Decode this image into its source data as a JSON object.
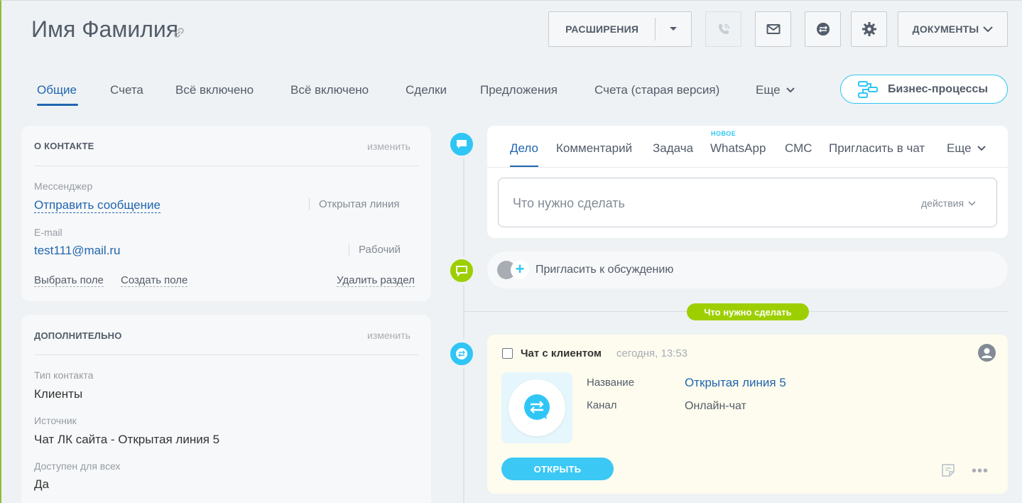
{
  "header": {
    "title": "Имя Фамилия",
    "extensions_label": "РАСШИРЕНИЯ",
    "documents_label": "ДОКУМЕНТЫ"
  },
  "tabs": [
    {
      "label": "Общие",
      "active": true
    },
    {
      "label": "Счета"
    },
    {
      "label": "Всё включено"
    },
    {
      "label": "Всё включено"
    },
    {
      "label": "Сделки"
    },
    {
      "label": "Предложения"
    },
    {
      "label": "Счета (старая версия)"
    },
    {
      "label": "Еще"
    }
  ],
  "business_processes_label": "Бизнес-процессы",
  "contact_card": {
    "title": "О КОНТАКТЕ",
    "edit_label": "изменить",
    "messenger_label": "Мессенджер",
    "messenger_value": "Отправить сообщение",
    "messenger_type": "Открытая линия",
    "email_label": "E-mail",
    "email_value": "test111@mail.ru",
    "email_type": "Рабочий",
    "choose_field": "Выбрать поле",
    "create_field": "Создать поле",
    "delete_section": "Удалить раздел"
  },
  "additional_card": {
    "title": "ДОПОЛНИТЕЛЬНО",
    "edit_label": "изменить",
    "contact_type_label": "Тип контакта",
    "contact_type_value": "Клиенты",
    "source_label": "Источник",
    "source_value": "Чат ЛК сайта - Открытая линия 5",
    "available_label": "Доступен для всех",
    "available_value": "Да"
  },
  "editor": {
    "tabs": [
      "Дело",
      "Комментарий",
      "Задача",
      "WhatsApp",
      "СМС",
      "Пригласить в чат",
      "Еще"
    ],
    "new_badge": "НОВОЕ",
    "placeholder": "Что нужно сделать",
    "actions_label": "действия"
  },
  "invite_label": "Пригласить к обсуждению",
  "todo_pill": "Что нужно сделать",
  "chat_item": {
    "title": "Чат с клиентом",
    "time": "сегодня, 13:53",
    "name_label": "Название",
    "name_value": "Открытая линия 5",
    "channel_label": "Канал",
    "channel_value": "Онлайн-чат",
    "open_label": "ОТКРЫТЬ",
    "more": "•••"
  },
  "colors": {
    "accent_blue": "#2066b0",
    "timeline_blue": "#2fc6f6",
    "timeline_green": "#9dcf00",
    "chat_bg": "#fefcee"
  }
}
